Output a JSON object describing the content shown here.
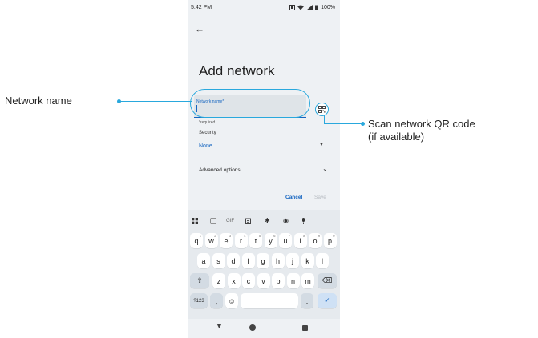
{
  "status_bar": {
    "time": "5:42 PM",
    "battery": "100%"
  },
  "screen": {
    "title": "Add network",
    "network_name_label": "Network name*",
    "required_note": "*required",
    "security_label": "Security",
    "security_value": "None",
    "advanced_options": "Advanced options",
    "cancel": "Cancel",
    "save": "Save"
  },
  "keyboard": {
    "toolbar": [
      "grid-icon",
      "sticker-icon",
      "GIF",
      "clipboard-icon",
      "settings-icon",
      "palette-icon",
      "mic-icon"
    ],
    "gif_label": "GIF",
    "row1": [
      "q",
      "w",
      "e",
      "r",
      "t",
      "y",
      "u",
      "i",
      "o",
      "p"
    ],
    "row1_hints": [
      "1",
      "2",
      "3",
      "4",
      "5",
      "6",
      "7",
      "8",
      "9",
      "0"
    ],
    "row2": [
      "a",
      "s",
      "d",
      "f",
      "g",
      "h",
      "j",
      "k",
      "l"
    ],
    "row3": [
      "z",
      "x",
      "c",
      "v",
      "b",
      "n",
      "m"
    ],
    "symbols": "?123",
    "comma": ",",
    "period": "."
  },
  "callouts": {
    "network_name": "Network name",
    "scan_qr_line1": "Scan network QR code",
    "scan_qr_line2": "(if available)"
  },
  "colors": {
    "accent": "#1565c0",
    "callout": "#29a8dd"
  }
}
